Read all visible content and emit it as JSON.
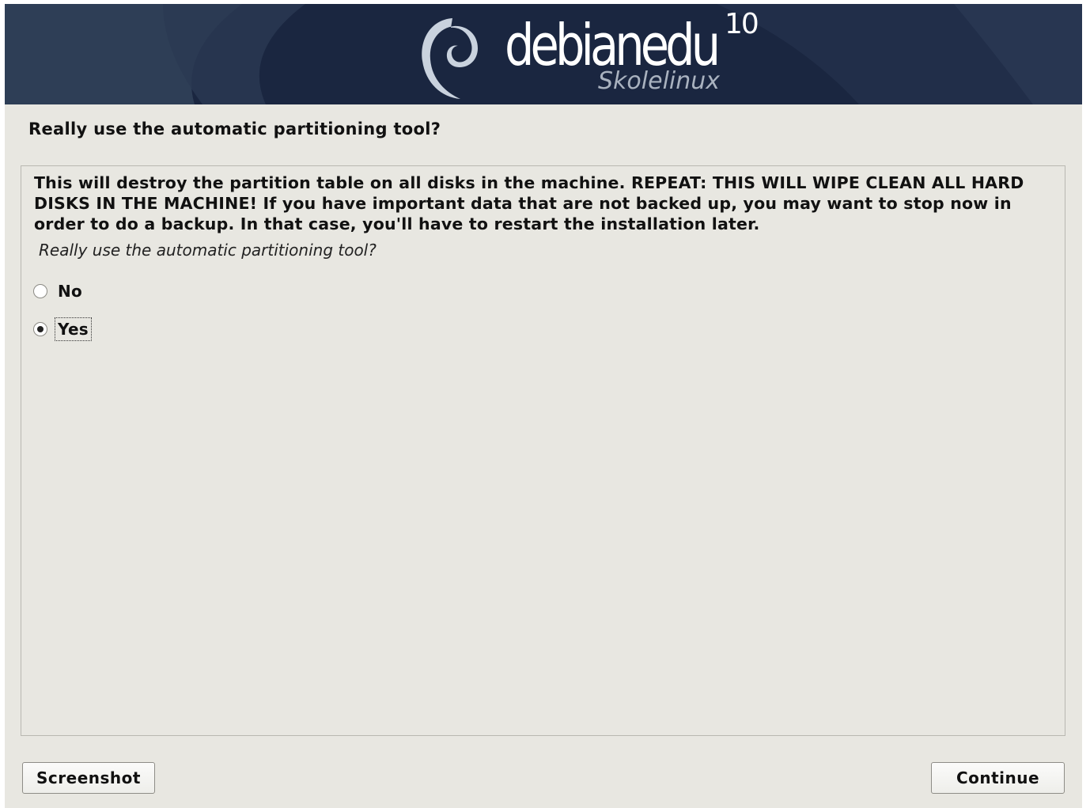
{
  "banner": {
    "logo_text": "debianedu",
    "version": "10",
    "subtitle": "Skolelinux",
    "colors": {
      "background": "#1a2640",
      "swirl": "#c9d2de"
    }
  },
  "page_title": "Really use the automatic partitioning tool?",
  "description": "This will destroy the partition table on all disks in the machine. REPEAT: THIS WILL WIPE CLEAN ALL HARD DISKS IN THE MACHINE! If you have important data that are not backed up, you may want to stop now in order to do a backup. In that case, you'll have to restart the installation later.",
  "question": "Really use the automatic partitioning tool?",
  "options": [
    {
      "label": "No",
      "selected": false
    },
    {
      "label": "Yes",
      "selected": true
    }
  ],
  "buttons": {
    "screenshot": "Screenshot",
    "continue": "Continue"
  }
}
